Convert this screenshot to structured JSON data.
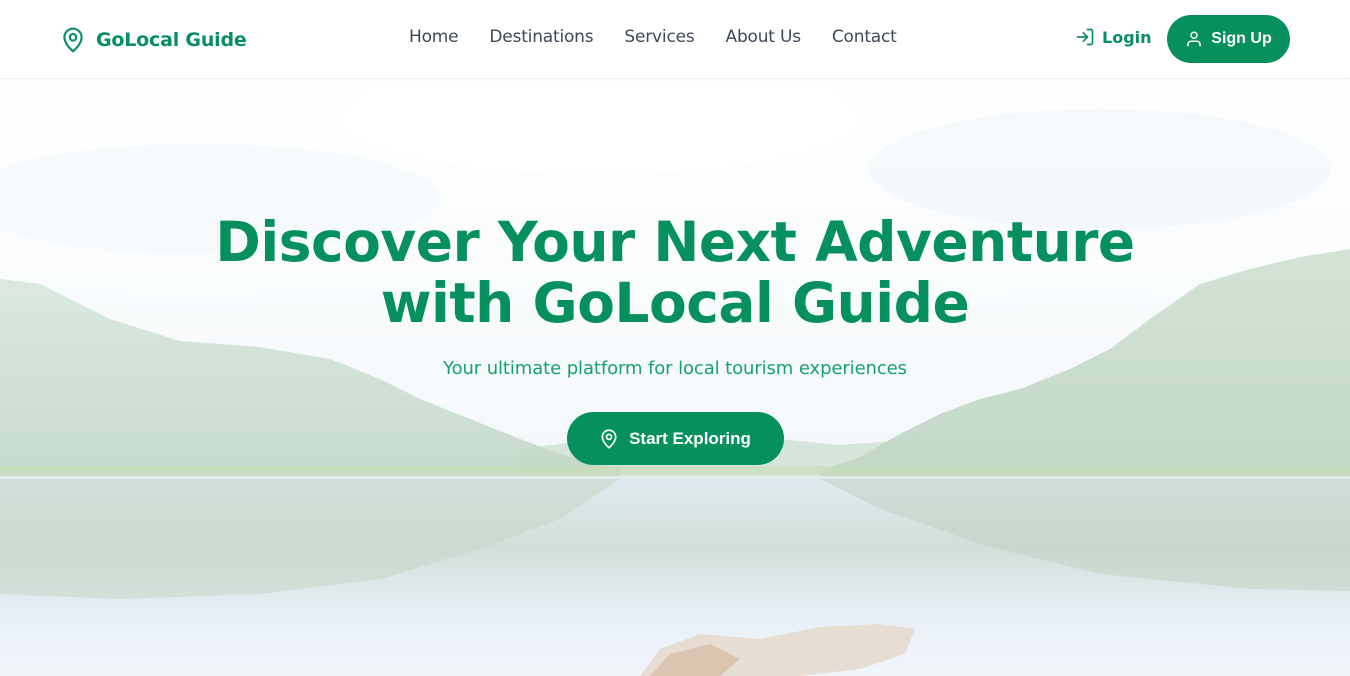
{
  "brand": {
    "name": "GoLocal Guide",
    "icon": "map-pin-icon"
  },
  "nav": {
    "links": [
      "Home",
      "Destinations",
      "Services",
      "About Us",
      "Contact"
    ]
  },
  "auth": {
    "login_label": "Login",
    "login_icon": "log-in-icon",
    "signup_label": "Sign Up",
    "signup_icon": "user-icon"
  },
  "hero": {
    "title_line1": "Discover Your Next Adventure",
    "title_line2": "with GoLocal Guide",
    "subtitle": "Your ultimate platform for local tourism experiences",
    "cta_label": "Start Exploring",
    "cta_icon": "map-pin-icon",
    "background": "mountain-lake-forest-photo"
  },
  "colors": {
    "accent": "#06905e",
    "nav_text": "#3f4956",
    "subtitle": "#15a36b"
  }
}
